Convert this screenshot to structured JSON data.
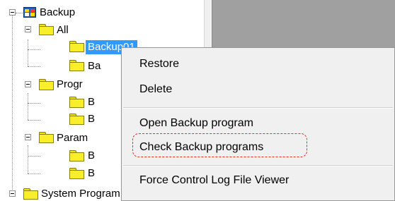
{
  "tree": {
    "root_label": "Backup",
    "all_label": "All",
    "selected_item_label": "Backup01",
    "child_b_label": "Ba",
    "program_label": "Progr",
    "parameter_label": "Param",
    "system_program_label": "System Program",
    "truncated_b_label": "B"
  },
  "context_menu": {
    "items": [
      "Restore",
      "Delete",
      "Open Backup program",
      "Check Backup programs",
      "Force Control Log File Viewer"
    ]
  },
  "colors": {
    "selection": "#3399ff",
    "highlight_dash": "#e0301e",
    "folder_yellow": "#f8ee2a",
    "right_pane_gray": "#a0a0a0"
  }
}
